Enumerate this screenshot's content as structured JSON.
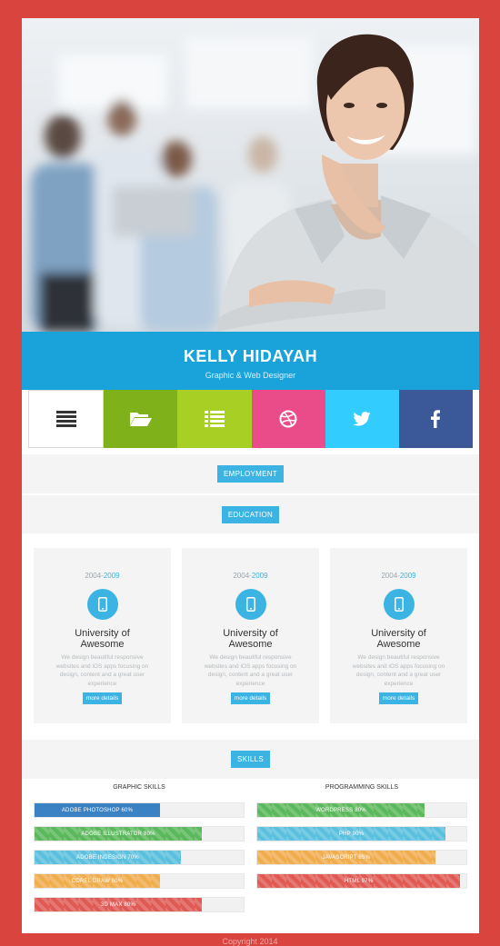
{
  "profile": {
    "name": "KELLY HIDAYAH",
    "role": "Graphic & Web Designer"
  },
  "social": [
    {
      "name": "menu",
      "icon": "menu-icon",
      "color": "#ffffff"
    },
    {
      "name": "portfolio",
      "icon": "folder-icon",
      "color": "#7fb11a"
    },
    {
      "name": "resume",
      "icon": "list-icon",
      "color": "#a8cf24"
    },
    {
      "name": "dribbble",
      "icon": "dribbble-icon",
      "color": "#ea4c89"
    },
    {
      "name": "twitter",
      "icon": "twitter-icon",
      "color": "#33ccff"
    },
    {
      "name": "facebook",
      "icon": "facebook-icon",
      "color": "#3b5998"
    }
  ],
  "sections": {
    "employment": "EMPLOYMENT",
    "education": "EDUCATION",
    "skills": "SKILLS"
  },
  "education": [
    {
      "year_start": "2004-",
      "year_end": "2009",
      "title": "University of Awesome",
      "desc": "We design beautiful responsive websites and iOS apps focusing on design, content and a great user experience",
      "button": "more details",
      "icon": "mobile-icon"
    },
    {
      "year_start": "2004-",
      "year_end": "2009",
      "title": "University of Awesome",
      "desc": "We design beautiful responsive websites and iOS apps focusing on design, content and a great user experience",
      "button": "more details",
      "icon": "mobile-icon"
    },
    {
      "year_start": "2004-",
      "year_end": "2009",
      "title": "University of Awesome",
      "desc": "We design beautiful responsive websites and iOS apps focusing on design, content and a great user experience",
      "button": "more details",
      "icon": "mobile-icon"
    }
  ],
  "skills": {
    "graphic_title": "GRAPHIC SKILLS",
    "programming_title": "PROGRAMMING SKILLS",
    "graphic": [
      {
        "label": "ADOBE PHOTOSHOP 60%",
        "value": 60,
        "color": "#3a82c4",
        "striped": false
      },
      {
        "label": "ADOBE ILLUSTRATOR 80%",
        "value": 80,
        "color": "#5cb85c",
        "striped": true
      },
      {
        "label": "ADOBE INDESIGN 70%",
        "value": 70,
        "color": "#5bc0de",
        "striped": true
      },
      {
        "label": "COREL DRAW 60%",
        "value": 60,
        "color": "#f0ad4e",
        "striped": true
      },
      {
        "label": "3D MAX 80%",
        "value": 80,
        "color": "#e05a55",
        "striped": true
      }
    ],
    "programming": [
      {
        "label": "WORDPRESS 80%",
        "value": 80,
        "color": "#5cb85c",
        "striped": true
      },
      {
        "label": "PHP 90%",
        "value": 90,
        "color": "#5bc0de",
        "striped": true
      },
      {
        "label": "JAVASCRIPT 85%",
        "value": 85,
        "color": "#f0ad4e",
        "striped": true
      },
      {
        "label": "HTML 97%",
        "value": 97,
        "color": "#e05a55",
        "striped": true
      }
    ]
  },
  "footer": "Copyright 2014"
}
